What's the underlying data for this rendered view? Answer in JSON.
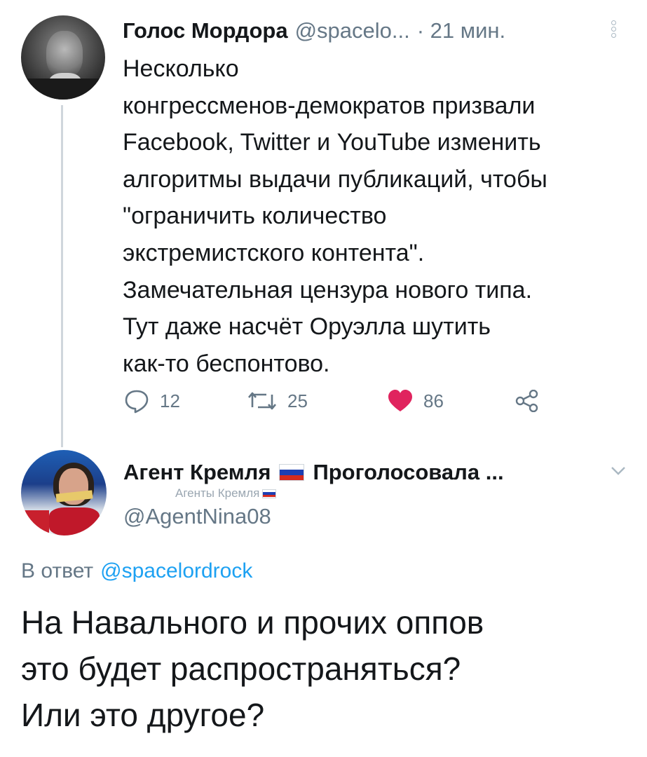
{
  "tweet1": {
    "author_name": "Голос Мордора",
    "author_handle": "@spacelo...",
    "time": "· 21 мин.",
    "text": "Несколько\nконгрессменов-демократов призвали\nFacebook, Twitter и YouTube изменить\nалгоритмы выдачи публикаций, чтобы\n\"ограничить количество\nэкстремистского контента\".\nЗамечательная цензура нового типа.\nТут даже насчёт Оруэлла шутить\nкак-то беспонтово.",
    "replies": "12",
    "retweets": "25",
    "likes": "86"
  },
  "tweet2": {
    "author_name": "Агент Кремля",
    "author_name_suffix": "Проголосовала ...",
    "badge": "Агенты Кремля",
    "author_handle": "@AgentNina08",
    "reply_prefix": "В ответ",
    "reply_to_handle": "@spacelordrock",
    "text": "На Навального и прочих оппов\nэто будет распространяться?\nИли это другое?"
  },
  "colors": {
    "text": "#14171a",
    "secondary": "#657786",
    "link": "#1da1f2",
    "like": "#e0245e",
    "thread_line": "#cfd6dc"
  },
  "icons": [
    "reply-icon",
    "retweet-icon",
    "heart-icon",
    "share-icon",
    "more-icon",
    "chevron-down-icon",
    "russian-flag-icon"
  ]
}
